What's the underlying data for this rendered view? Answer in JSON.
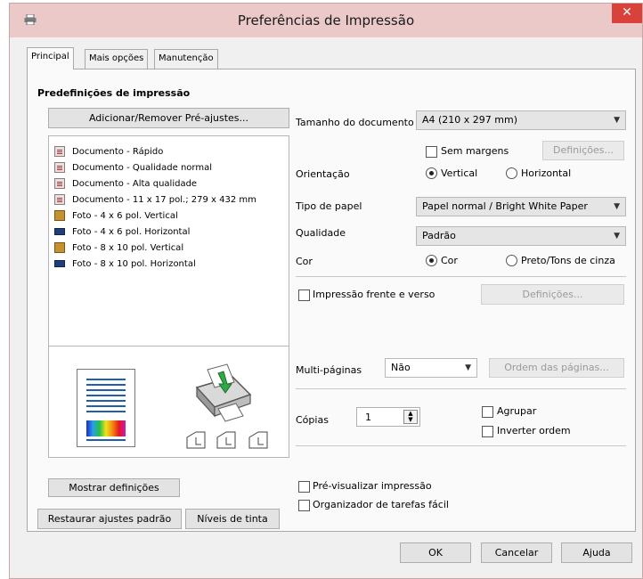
{
  "window": {
    "title": "Preferências de Impressão",
    "close_label": "✕"
  },
  "tabs": [
    "Principal",
    "Mais opções",
    "Manutenção"
  ],
  "presets": {
    "heading": "Predefinições de impressão",
    "add_remove_button": "Adicionar/Remover Pré-ajustes...",
    "items": [
      {
        "label": "Documento - Rápido",
        "icon": "document-icon"
      },
      {
        "label": "Documento - Qualidade normal",
        "icon": "document-icon"
      },
      {
        "label": "Documento - Alta qualidade",
        "icon": "document-icon"
      },
      {
        "label": "Documento - 11 x 17 pol.; 279 x 432 mm",
        "icon": "document-icon"
      },
      {
        "label": "Foto - 4 x 6 pol. Vertical",
        "icon": "photo-vertical-icon"
      },
      {
        "label": "Foto - 4 x 6 pol. Horizontal",
        "icon": "photo-horizontal-icon"
      },
      {
        "label": "Foto - 8 x 10 pol. Vertical",
        "icon": "photo-vertical-icon"
      },
      {
        "label": "Foto - 8 x 10 pol. Horizontal",
        "icon": "photo-horizontal-icon"
      }
    ]
  },
  "left_buttons": {
    "show_settings": "Mostrar definições",
    "restore_defaults": "Restaurar ajustes padrão",
    "ink_levels": "Níveis de tinta"
  },
  "settings": {
    "doc_size_label": "Tamanho do documento",
    "doc_size_value": "A4 (210 x 297 mm)",
    "borderless_label": "Sem margens",
    "borderless_settings_button": "Definições...",
    "orientation_label": "Orientação",
    "orientation_vertical": "Vertical",
    "orientation_horizontal": "Horizontal",
    "orientation_selected": "Vertical",
    "paper_type_label": "Tipo de papel",
    "paper_type_value": "Papel normal / Bright White Paper",
    "quality_label": "Qualidade",
    "quality_value": "Padrão",
    "color_label": "Cor",
    "color_option": "Cor",
    "grayscale_option": "Preto/Tons de cinza",
    "color_selected": "Cor",
    "duplex_label": "Impressão frente e verso",
    "duplex_settings_button": "Definições...",
    "multipage_label": "Multi-páginas",
    "multipage_value": "Não",
    "page_order_button": "Ordem das páginas...",
    "copies_label": "Cópias",
    "copies_value": "1",
    "collate_label": "Agrupar",
    "reverse_order_label": "Inverter ordem",
    "print_preview_label": "Pré-visualizar impressão",
    "job_arranger_label": "Organizador de tarefas fácil"
  },
  "footer": {
    "ok": "OK",
    "cancel": "Cancelar",
    "help": "Ajuda"
  },
  "colors": {
    "titlebar": "#ebc9c9",
    "close_button": "#d9423a",
    "radio_on": "#222222"
  }
}
